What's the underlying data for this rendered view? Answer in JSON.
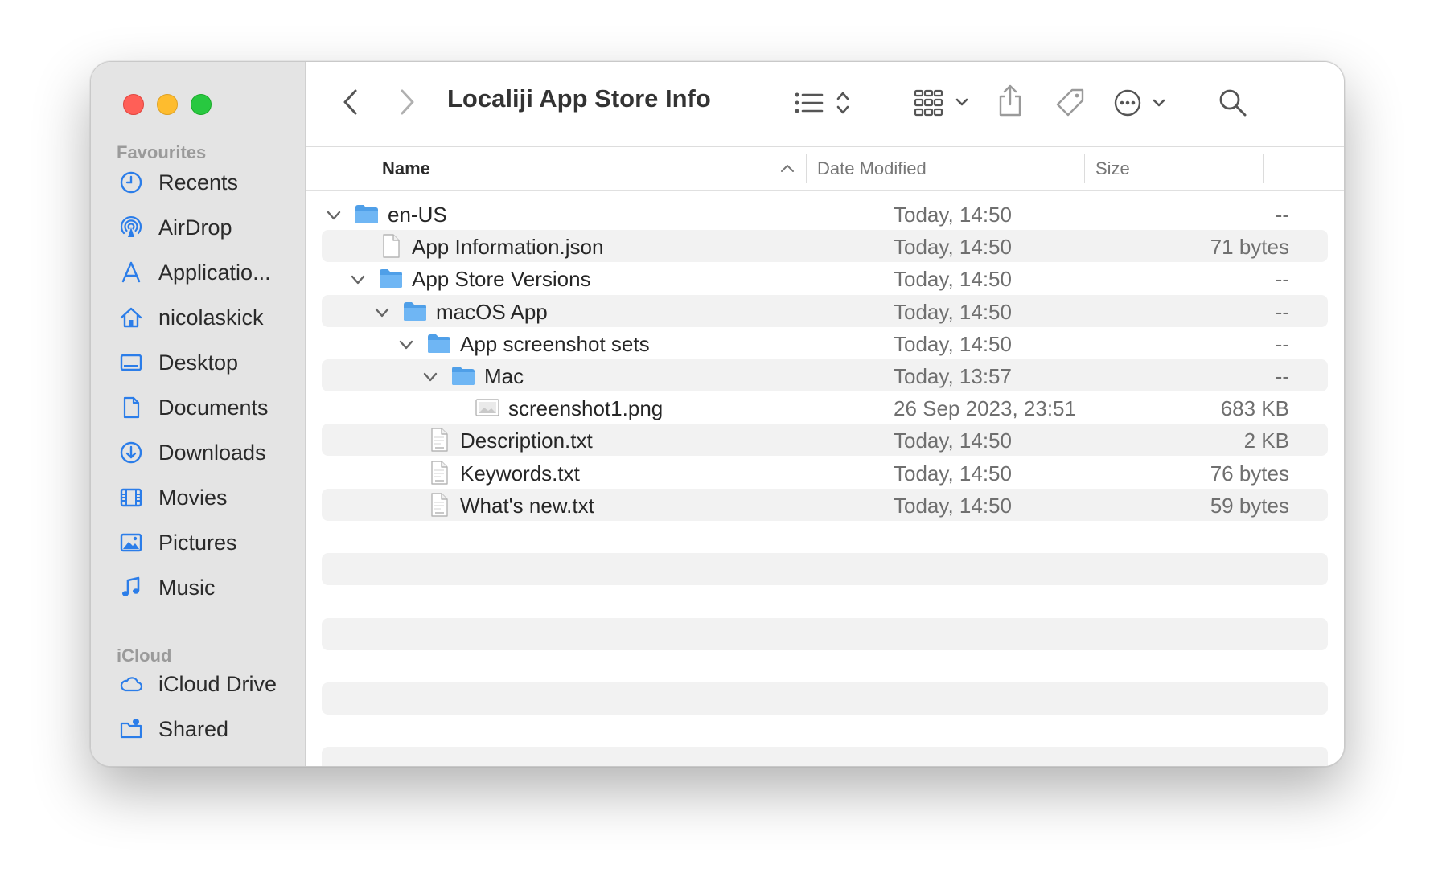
{
  "window": {
    "title": "Localiji App Store Info"
  },
  "sidebar": {
    "sections": [
      {
        "label": "Favourites",
        "items": [
          {
            "label": "Recents",
            "icon": "clock-icon"
          },
          {
            "label": "AirDrop",
            "icon": "airdrop-icon"
          },
          {
            "label": "Applicatio...",
            "icon": "applications-icon"
          },
          {
            "label": "nicolaskick",
            "icon": "home-icon"
          },
          {
            "label": "Desktop",
            "icon": "desktop-icon"
          },
          {
            "label": "Documents",
            "icon": "document-icon"
          },
          {
            "label": "Downloads",
            "icon": "download-icon"
          },
          {
            "label": "Movies",
            "icon": "film-icon"
          },
          {
            "label": "Pictures",
            "icon": "photo-icon"
          },
          {
            "label": "Music",
            "icon": "music-note-icon"
          }
        ]
      },
      {
        "label": "iCloud",
        "items": [
          {
            "label": "iCloud Drive",
            "icon": "cloud-icon"
          },
          {
            "label": "Shared",
            "icon": "shared-folder-icon"
          }
        ]
      }
    ]
  },
  "columns": {
    "name": "Name",
    "date": "Date Modified",
    "size": "Size",
    "sort": "name-ascending"
  },
  "files": [
    {
      "name": "en-US",
      "date": "Today, 14:50",
      "size": "--",
      "type": "folder",
      "depth": 0,
      "expanded": true
    },
    {
      "name": "App Information.json",
      "date": "Today, 14:50",
      "size": "71 bytes",
      "type": "file",
      "depth": 1
    },
    {
      "name": "App Store Versions",
      "date": "Today, 14:50",
      "size": "--",
      "type": "folder",
      "depth": 1,
      "expanded": true
    },
    {
      "name": "macOS App",
      "date": "Today, 14:50",
      "size": "--",
      "type": "folder",
      "depth": 2,
      "expanded": true
    },
    {
      "name": "App screenshot sets",
      "date": "Today, 14:50",
      "size": "--",
      "type": "folder",
      "depth": 3,
      "expanded": true
    },
    {
      "name": "Mac",
      "date": "Today, 13:57",
      "size": "--",
      "type": "folder",
      "depth": 4,
      "expanded": true
    },
    {
      "name": "screenshot1.png",
      "date": "26 Sep 2023, 23:51",
      "size": "683 KB",
      "type": "image",
      "depth": 5
    },
    {
      "name": "Description.txt",
      "date": "Today, 14:50",
      "size": "2 KB",
      "type": "txt",
      "depth": 3
    },
    {
      "name": "Keywords.txt",
      "date": "Today, 14:50",
      "size": "76 bytes",
      "type": "txt",
      "depth": 3
    },
    {
      "name": "What's new.txt",
      "date": "Today, 14:50",
      "size": "59 bytes",
      "type": "txt",
      "depth": 3
    }
  ],
  "colors": {
    "accent": "#2b7de9",
    "folder": "#5aa8f0",
    "sidebar_bg": "#e4e4e4"
  }
}
